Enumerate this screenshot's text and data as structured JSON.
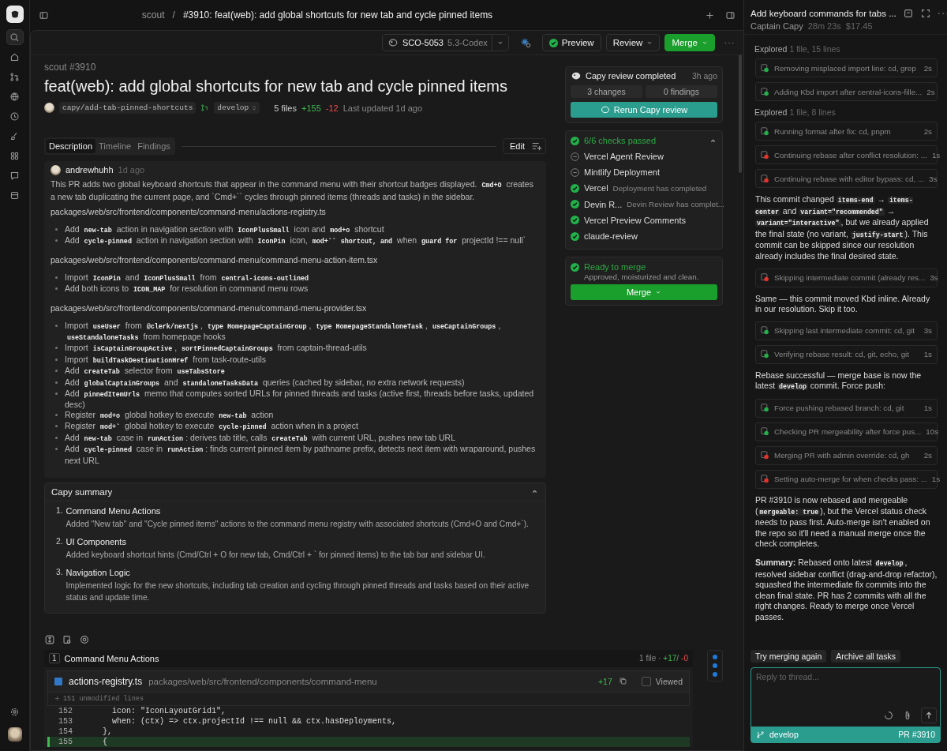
{
  "topbar": {
    "repo": "scout",
    "separator": "/",
    "title": "#3910: feat(web): add global shortcuts for new tab and cycle pinned items"
  },
  "toolbar": {
    "ticket": "SCO-5053",
    "model": "5.3-Codex",
    "preview": "Preview",
    "review": "Review",
    "merge": "Merge"
  },
  "pr": {
    "repo": "scout #3910",
    "title": "feat(web): add global shortcuts for new tab and cycle pinned items",
    "branch": "capy/add-tab-pinned-shortcuts",
    "base": "develop",
    "files": "5 files",
    "additions": "+155",
    "deletions": "-12",
    "updated": "Last updated 1d ago"
  },
  "tabs": [
    {
      "label": "Description",
      "selected": true
    },
    {
      "label": "Timeline",
      "selected": false
    },
    {
      "label": "Findings",
      "selected": false
    }
  ],
  "edit": "Edit",
  "comment": {
    "author": "andrewhuhh",
    "time": "1d ago",
    "blocks": [
      {
        "kind": "para",
        "parts": [
          "This PR adds two global keyboard shortcuts that appear in the command menu with their shortcut badges displayed. ",
          {
            "code": "Cmd+O"
          },
          " creates a new tab duplicating the current page, and `Cmd+`` cycles through pinned items (threads and tasks) in the sidebar."
        ]
      },
      {
        "kind": "path",
        "text": "packages/web/src/frontend/components/command-menu/actions-registry.ts"
      },
      {
        "kind": "list",
        "items": [
          [
            "Add ",
            {
              "code": "new-tab"
            },
            " action in navigation section with ",
            {
              "code": "IconPlusSmall"
            },
            " icon and ",
            {
              "code": "mod+o"
            },
            " shortcut"
          ],
          [
            "Add ",
            {
              "code": "cycle-pinned"
            },
            " action in navigation section with ",
            {
              "code": "IconPin"
            },
            " icon, ",
            {
              "code": "mod+``"
            },
            {
              "code": "shortcut, and"
            },
            " when ",
            {
              "code": "guard for"
            },
            " projectId !== null`"
          ]
        ]
      },
      {
        "kind": "path",
        "text": "packages/web/src/frontend/components/command-menu/command-menu-action-item.tsx"
      },
      {
        "kind": "list",
        "items": [
          [
            "Import ",
            {
              "code": "IconPin"
            },
            " and ",
            {
              "code": "IconPlusSmall"
            },
            " from ",
            {
              "code": "central-icons-outlined"
            }
          ],
          [
            "Add both icons to ",
            {
              "code": "ICON_MAP"
            },
            " for resolution in command menu rows"
          ]
        ]
      },
      {
        "kind": "path",
        "text": "packages/web/src/frontend/components/command-menu/command-menu-provider.tsx"
      },
      {
        "kind": "list",
        "items": [
          [
            "Import ",
            {
              "code": "useUser"
            },
            " from ",
            {
              "code": "@clerk/nextjs"
            },
            ", ",
            {
              "code": "type HomepageCaptainGroup"
            },
            ", ",
            {
              "code": "type HomepageStandaloneTask"
            },
            ", ",
            {
              "code": "useCaptainGroups"
            },
            ", ",
            {
              "code": "useStandaloneTasks"
            },
            " from homepage hooks"
          ],
          [
            "Import ",
            {
              "code": "isCaptainGroupActive"
            },
            ", ",
            {
              "code": "sortPinnedCaptainGroups"
            },
            " from captain-thread-utils"
          ],
          [
            "Import ",
            {
              "code": "buildTaskDestinationHref"
            },
            " from task-route-utils"
          ],
          [
            "Add ",
            {
              "code": "createTab"
            },
            " selector from ",
            {
              "code": "useTabsStore"
            }
          ],
          [
            "Add ",
            {
              "code": "globalCaptainGroups"
            },
            " and ",
            {
              "code": "standaloneTasksData"
            },
            " queries (cached by sidebar, no extra network requests)"
          ],
          [
            "Add ",
            {
              "code": "pinnedItemUrls"
            },
            " memo that computes sorted URLs for pinned threads and tasks (active first, threads before tasks, updated desc)"
          ],
          [
            "Register ",
            {
              "code": "mod+o"
            },
            " global hotkey to execute ",
            {
              "code": "new-tab"
            },
            " action"
          ],
          [
            "Register ",
            {
              "code": "mod+`"
            },
            " global hotkey to execute ",
            {
              "code": "cycle-pinned"
            },
            " action when in a project"
          ],
          [
            "Add ",
            {
              "code": "new-tab"
            },
            " case in ",
            {
              "code": "runAction"
            },
            ": derives tab title, calls ",
            {
              "code": "createTab"
            },
            " with current URL, pushes new tab URL"
          ],
          [
            "Add ",
            {
              "code": "cycle-pinned"
            },
            " case in ",
            {
              "code": "runAction"
            },
            ": finds current pinned item by pathname prefix, detects next item with wraparound, pushes next URL"
          ]
        ]
      }
    ]
  },
  "summary": {
    "title": "Capy summary",
    "expanded": true,
    "items": [
      {
        "number": "1.",
        "title": "Command Menu Actions",
        "text": "Added \"New tab\" and \"Cycle pinned items\" actions to the command menu registry with associated shortcuts (Cmd+O and Cmd+`)."
      },
      {
        "number": "2.",
        "title": "UI Components",
        "text": "Added keyboard shortcut hints (Cmd/Ctrl + O for new tab, Cmd/Ctrl + ` for pinned items) to the tab bar and sidebar UI."
      },
      {
        "number": "3.",
        "title": "Navigation Logic",
        "text": "Implemented logic for the new shortcuts, including tab creation and cycling through pinned threads and tasks based on their active status and update time."
      }
    ]
  },
  "review": {
    "title": "Capy review completed",
    "time": "3h ago",
    "changes": "3 changes",
    "findings": "0 findings",
    "rerun": "Rerun Capy review"
  },
  "checks": {
    "title": "6/6 checks passed",
    "expanded": true,
    "items": [
      {
        "name": "Vercel Agent Review",
        "skipped": true
      },
      {
        "name": "Mintlify Deployment",
        "skipped": true
      },
      {
        "name": "Vercel",
        "detail": "Deployment has completed",
        "skipped": false
      },
      {
        "name": "Devin R...",
        "detail": "Devin Review has complet...",
        "skipped": false
      },
      {
        "name": "Vercel Preview Comments",
        "skipped": false
      },
      {
        "name": "claude-review",
        "skipped": false
      }
    ]
  },
  "ready": {
    "title": "Ready to merge",
    "text": "Approved, moisturized and clean.",
    "button": "Merge"
  },
  "diff": {
    "index": "1",
    "group": "Command Menu Actions",
    "files": "1 file ·",
    "additions": "+17",
    "separator": "/",
    "deletions": "-0",
    "file": {
      "name": "actions-registry.ts",
      "path": "packages/web/src/frontend/components/command-menu",
      "additions": "+17",
      "viewed": false,
      "viewed_label": "Viewed"
    },
    "collapsed": "151 unmodified lines",
    "lines": [
      {
        "num": "152",
        "added": false,
        "text": "    icon: \"IconLayoutGrid1\","
      },
      {
        "num": "153",
        "added": false,
        "text": "    when: (ctx) => ctx.projectId !== null && ctx.hasDeployments,"
      },
      {
        "num": "154",
        "added": false,
        "text": "  },"
      },
      {
        "num": "155",
        "added": true,
        "text": "  {"
      }
    ]
  },
  "thread": {
    "title": "Add keyboard commands for tabs ...",
    "author": "Captain Capy",
    "duration": "28m 23s",
    "cost": "$17.45",
    "items": [
      {
        "kind": "explored",
        "label": "Explored",
        "detail": "1 file, 15 lines"
      },
      {
        "kind": "step",
        "text": "Removing misplaced import line: cd, grep",
        "time": "2s",
        "ok": true
      },
      {
        "kind": "step",
        "text": "Adding Kbd import after central-icons-fille...",
        "time": "2s",
        "ok": true
      },
      {
        "kind": "explored",
        "label": "Explored",
        "detail": "1 file, 8 lines"
      },
      {
        "kind": "step",
        "text": "Running format after fix: cd, pnpm",
        "time": "2s",
        "ok": true
      },
      {
        "kind": "step",
        "text": "Continuing rebase after conflict resolution: ...",
        "time": "1s",
        "ok": false
      },
      {
        "kind": "step",
        "text": "Continuing rebase with editor bypass: cd, ...",
        "time": "3s",
        "ok": false
      },
      {
        "kind": "message",
        "parts": [
          "This commit changed ",
          {
            "code": "items-end"
          },
          " → ",
          {
            "code": "items-center"
          },
          " and ",
          {
            "code": "variant=\"recommended\""
          },
          " → ",
          {
            "code": "variant=\"interactive\""
          },
          ", but we already applied the final state (no variant, ",
          {
            "code": "justify-start"
          },
          "). This commit can be skipped since our resolution already includes the final desired state."
        ]
      },
      {
        "kind": "step",
        "text": "Skipping intermediate commit (already res...",
        "time": "3s",
        "ok": false
      },
      {
        "kind": "message",
        "parts": [
          "Same — this commit moved Kbd inline. Already in our resolution. Skip it too."
        ]
      },
      {
        "kind": "step",
        "text": "Skipping last intermediate commit: cd, git",
        "time": "3s",
        "ok": true
      },
      {
        "kind": "step",
        "text": "Verifying rebase result: cd, git, echo, git",
        "time": "1s",
        "ok": true
      },
      {
        "kind": "message",
        "parts": [
          "Rebase successful — merge base is now the latest ",
          {
            "code": "develop"
          },
          " commit. Force push:"
        ]
      },
      {
        "kind": "step",
        "text": "Force pushing rebased branch: cd, git",
        "time": "1s",
        "ok": true
      },
      {
        "kind": "step",
        "text": "Checking PR mergeability after force pus...",
        "time": "10s",
        "ok": true
      },
      {
        "kind": "step",
        "text": "Merging PR with admin override: cd, gh",
        "time": "2s",
        "ok": false
      },
      {
        "kind": "step",
        "text": "Setting auto-merge for when checks pass: ...",
        "time": "1s",
        "ok": false
      },
      {
        "kind": "message",
        "parts": [
          "PR #3910 is now rebased and mergeable (",
          {
            "code": "mergeable: true"
          },
          "), but the Vercel status check needs to pass first. Auto-merge isn't enabled on the repo so it'll need a manual merge once the check completes."
        ]
      },
      {
        "kind": "message",
        "parts": [
          "**Summary:** Rebased onto latest ",
          {
            "code": "develop"
          },
          ", resolved sidebar conflict (drag-and-drop refactor), squashed the intermediate fix commits into the clean final state. PR has 2 commits with all the right changes. Ready to merge once Vercel passes."
        ]
      }
    ],
    "actions": [
      "Try merging again",
      "Archive all tasks"
    ],
    "reply": {
      "placeholder": "Reply to thread..."
    },
    "branch": "develop",
    "pr": "PR #3910"
  }
}
